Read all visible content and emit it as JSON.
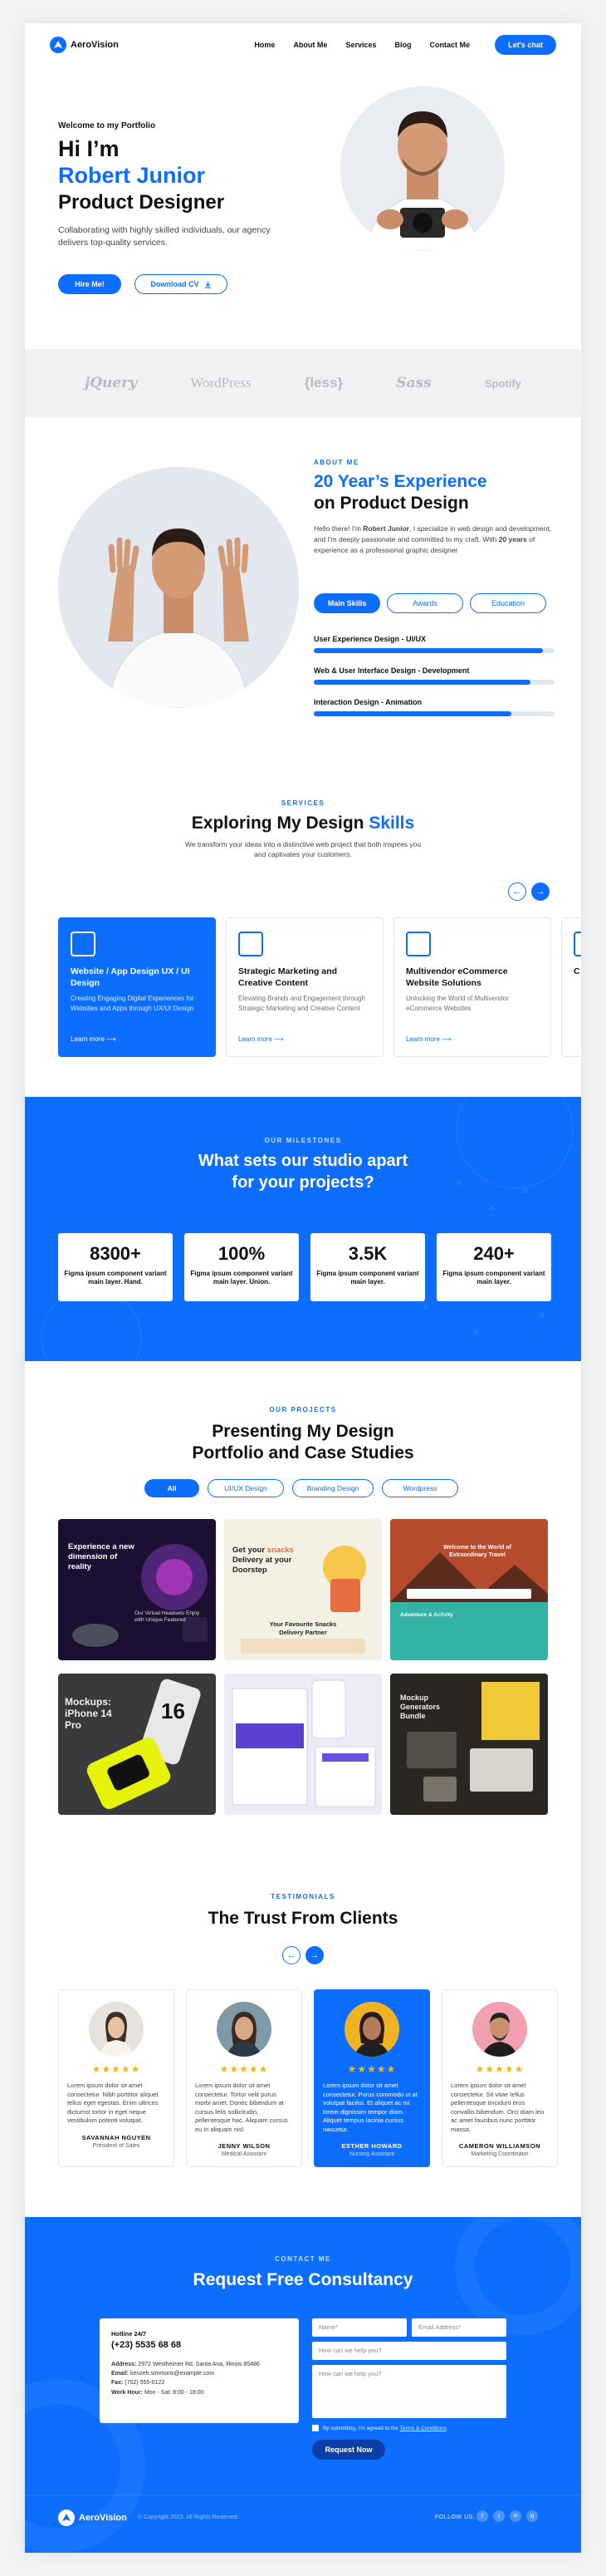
{
  "header": {
    "logo_text": "AeroVision",
    "nav": [
      "Home",
      "About Me",
      "Services",
      "Blog",
      "Contact Me"
    ],
    "cta": "Let's chat"
  },
  "hero": {
    "welcome": "Welcome to my Portfolio",
    "greeting": "Hi I’m",
    "name": "Robert Junior",
    "role": "Product Designer",
    "desc": "Collaborating with highly skilled individuals, our agency delivers top-quality services.",
    "hire": "Hire Me!",
    "download": "Download CV"
  },
  "brands": [
    "jQuery",
    "WordPress",
    "{less}",
    "Sass",
    "Spotify"
  ],
  "about": {
    "eyebrow": "ABOUT ME",
    "title_blue": "20 Year’s Experience",
    "title_dark": "on Product Design",
    "desc_pre": "Hello there! I'm ",
    "desc_name": "Robert Junior",
    "desc_mid": ", I specialize in web design and development, and I'm deeply passionate and committed to my craft. With ",
    "desc_years": "20 years",
    "desc_post": " of experience as a professional graphic designer",
    "tabs": [
      "Main Skills",
      "Awards",
      "Education"
    ],
    "skills": [
      {
        "label": "User Experience Design - UI/UX",
        "value": 0.95
      },
      {
        "label": "Web & User Interface Design - Development",
        "value": 0.9
      },
      {
        "label": "Interaction Design - Animation",
        "value": 0.82
      }
    ]
  },
  "services": {
    "eyebrow": "SERVICES",
    "title_dark": "Exploring My Design",
    "title_blue": "Skills",
    "desc": "We transform your ideas into a distinctive web project that both inspires you and captivates your customers.",
    "cards": [
      {
        "title": "Website / App Design UX / UI Design",
        "desc": "Creating Engaging Digital Experiences for Websites and Apps through UX/UI Design",
        "more": "Learn more"
      },
      {
        "title": "Strategic Marketing and Creative Content",
        "desc": "Elevating Brands and Engagement through Strategic Marketing and Creative Content",
        "more": "Learn more"
      },
      {
        "title": "Multivendor eCommerce Website Solutions",
        "desc": "Unlocking the World of Multivendor eCommerce Websites",
        "more": "Learn more"
      },
      {
        "title": "C",
        "desc": "",
        "more": ""
      }
    ]
  },
  "milestones": {
    "eyebrow": "OUR MILESTONES",
    "title_line1": "What sets our studio apart",
    "title_line2": "for your projects?",
    "stats": [
      {
        "num": "8300+",
        "cap": "Figma ipsum component variant main layer. Hand."
      },
      {
        "num": "100%",
        "cap": "Figma ipsum component variant main layer. Union."
      },
      {
        "num": "3.5K",
        "cap": "Figma ipsum component variant main layer."
      },
      {
        "num": "240+",
        "cap": "Figma ipsum component variant main layer."
      }
    ]
  },
  "projects": {
    "eyebrow": "OUR PROJECTS",
    "title_line1": "Presenting My Design",
    "title_line2": "Portfolio and Case Studies",
    "filters": [
      "All",
      "UI/UX Design",
      "Branding Design",
      "Wordpress"
    ],
    "p1_title": "Experience a new dimension of reality",
    "p1_sub": "Our Virtual Headsets Enjoy with Unique Featured",
    "p2_title_pre": "Get your ",
    "p2_title_accent": "snacks",
    "p2_title_post": " Delivery at your Doorstep",
    "p2_sub": "Your Favourite Snacks Delivery Partner",
    "p3_title": "Welcome to the World of Extraordinary Travel",
    "p3_sub": "Adventure & Activity",
    "p4_title": "Mockups: iPhone 14 Pro",
    "p4_num": "16",
    "p6_title": "Mockup Generators Bundle"
  },
  "testimonials": {
    "eyebrow": "TESTIMONIALS",
    "title": "The Trust From Clients",
    "stars": "★★★★★",
    "items": [
      {
        "quote": "Lorem ipsum dolor sit amet consectetur. Nibh porttitor aliquet tellus eget egestas. Enim ultrices dictumst tortor in eget neque vestibulum potenti volutpat.",
        "name": "SAVANNAH NGUYEN",
        "role": "President of Sales",
        "bg": "#e6e2de"
      },
      {
        "quote": "Lorem ipsum dolor sit amet consectetur. Tortor velit purus morbi amet. Donec bibendum at cursus felis sollicitudin, pellentesque hac. Aliquam cursus eu in aliquam nisl.",
        "name": "JENNY WILSON",
        "role": "Medical Assistant",
        "bg": "#7f99a6"
      },
      {
        "quote": "Lorem ipsum dolor sit amet consectetur. Purus commodo ut at volutpat facilisi. Et aliquet ac mi lorem dignissim tempor diam. Aliquet tempus lacinia cursus nascetur.",
        "name": "ESTHER HOWARD",
        "role": "Nursing Assistant",
        "bg": "#f0b324"
      },
      {
        "quote": "Lorem ipsum dolor sit amet consectetur. Sit vitae tellus pellentesque tincidunt eros convallis bibendum. Orci diam leo ac amet faucibus nunc porttitor massa.",
        "name": "CAMERON WILLIAMSON",
        "role": "Marketing Coordinator",
        "bg": "#f2a0b1"
      }
    ]
  },
  "contact": {
    "eyebrow": "CONTACT ME",
    "title": "Request Free Consultancy",
    "phone_label": "Hotline 24/7",
    "phone": "(+23) 5535 68 68",
    "address_label": "Address:",
    "address": "2972 Westheimer Rd. Santa Ana, Illinois 85486",
    "email_label": "Email:",
    "email": "kenzeh.simmons@example.com",
    "fax_label": "Fax:",
    "fax": "(702) 555-0122",
    "hours_label": "Work Hour:",
    "hours": "Mon - Sat: 8:00 - 18:00",
    "ph_name": "Name*",
    "ph_email": "Email Address*",
    "ph_help": "How can we help you?",
    "ph_message": "How can we help you?",
    "agree_pre": "By submitting, i'm agreed to the ",
    "agree_link": "Terms & Conditions",
    "submit": "Request Now"
  },
  "footer": {
    "logo_text": "AeroVision",
    "copyright": "© Copyright 2023. All Rights Reserved.",
    "follow": "FOLLOW US:",
    "socials": [
      "f",
      "t",
      "in",
      "ig"
    ]
  },
  "colors": {
    "accent": "#0d6efd",
    "dark": "#111111",
    "star": "#f5b50a"
  }
}
